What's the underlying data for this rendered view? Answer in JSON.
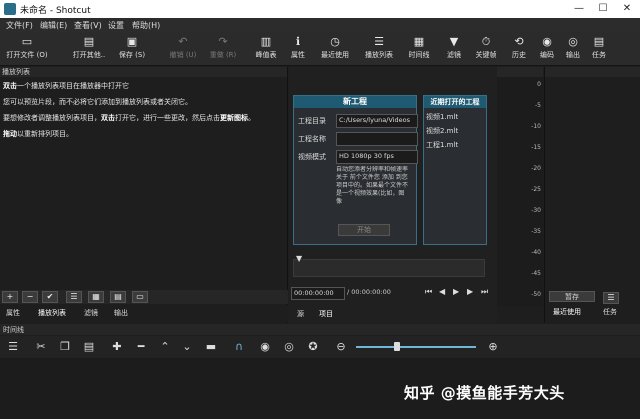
{
  "window": {
    "title": "未命名 - Shotcut",
    "minimize": "—",
    "maximize": "☐",
    "close": "✕"
  },
  "menu": [
    "文件(F)",
    "编辑(E)",
    "查看(V)",
    "设置",
    "帮助(H)"
  ],
  "toolbar": [
    {
      "label": "打开文件 (O)",
      "icon": "folder-icon",
      "glyph": "▭"
    },
    {
      "label": "打开其他..",
      "icon": "open-other-icon",
      "glyph": "▤"
    },
    {
      "label": "保存 (S)",
      "icon": "save-icon",
      "glyph": "▣"
    },
    {
      "label": "撤销 (U)",
      "icon": "undo-icon",
      "glyph": "↶"
    },
    {
      "label": "重做 (R)",
      "icon": "redo-icon",
      "glyph": "↷"
    },
    {
      "label": "峰值表",
      "icon": "peak-meter-icon",
      "glyph": "▥"
    },
    {
      "label": "属性",
      "icon": "properties-icon",
      "glyph": "ℹ"
    },
    {
      "label": "最近使用",
      "icon": "recent-icon",
      "glyph": "◷"
    },
    {
      "label": "播放列表",
      "icon": "playlist-icon",
      "glyph": "☰"
    },
    {
      "label": "时间线",
      "icon": "timeline-icon",
      "glyph": "▦"
    },
    {
      "label": "滤镜",
      "icon": "filter-icon",
      "glyph": "▼"
    },
    {
      "label": "关键帧",
      "icon": "keyframe-icon",
      "glyph": "⏱"
    },
    {
      "label": "历史",
      "icon": "history-icon",
      "glyph": "⟲"
    },
    {
      "label": "编码",
      "icon": "encode-icon",
      "glyph": "◉"
    },
    {
      "label": "输出",
      "icon": "export-icon",
      "glyph": "◎"
    },
    {
      "label": "任务",
      "icon": "jobs-icon",
      "glyph": "▤"
    }
  ],
  "playlist": {
    "header": "播放列表",
    "p1_b": "双击",
    "p1": "一个播放列表项目在播放器中打开它",
    "p2": "您可以预览片段，而不必将它们添加到播放列表或者关闭它。",
    "p3a": "要想修改者调整播放列表项目，",
    "p3_b": "双击",
    "p3b": "打开它，进行一些更改，然后点击",
    "p3_b2": "更新图标",
    "p3c": "。",
    "p4_b": "拖动",
    "p4": "以重新排列项目。",
    "buttons": [
      "+",
      "−",
      "✔",
      "☰",
      "▦",
      "▤",
      "▭"
    ],
    "tabs": [
      "属性",
      "播放列表",
      "滤镜",
      "输出"
    ]
  },
  "new_project": {
    "title": "新工程",
    "dir_label": "工程目录",
    "dir_value": "C:/Users/lyuna/Videos",
    "name_label": "工程名称",
    "name_value": "",
    "mode_label": "视频模式",
    "mode_value": "HD 1080p 30 fps",
    "help_text": "自动您添者分辨率和帧速率关于 前个文件您 添加 到您项目中的。如果最个文件不是一个视频效果(比如，图像",
    "start_button": "开始"
  },
  "recent": {
    "title": "近期打开的工程",
    "items": [
      "视频1.mlt",
      "视频2.mlt",
      "工程1.mlt"
    ]
  },
  "player": {
    "timecode": "00:00:00:00",
    "duration": "/ 00:00:00:00",
    "tabs": [
      "源",
      "项目"
    ]
  },
  "meter": {
    "labels": [
      "0",
      "-5",
      "-10",
      "-15",
      "-20",
      "-25",
      "-30",
      "-35",
      "-40",
      "-45",
      "-50"
    ]
  },
  "right_panel": {
    "button_text": "暂存",
    "tabs": [
      "最近使用",
      "任务"
    ]
  },
  "timeline": {
    "header": "时间线"
  },
  "watermark": "知乎 @摸鱼能手芳大头",
  "colors": {
    "accent": "#1f5a73",
    "bg": "#1e1e1e"
  }
}
